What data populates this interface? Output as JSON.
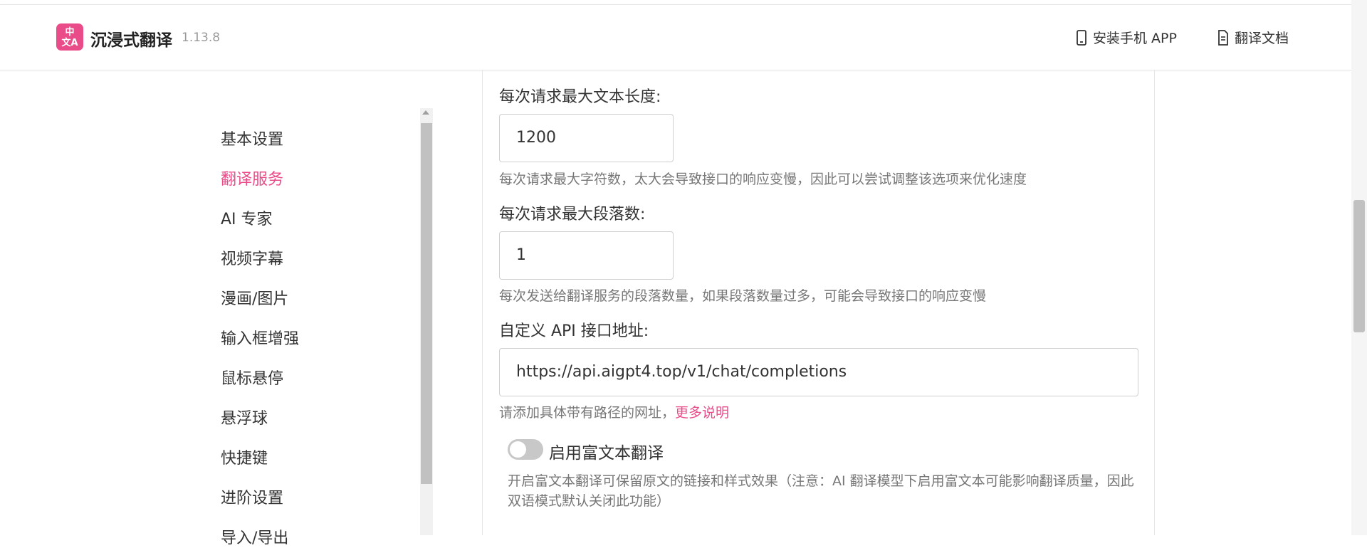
{
  "header": {
    "logo_text_top": "中",
    "logo_text_bottom": "文A",
    "app_title": "沉浸式翻译",
    "version": "1.13.8",
    "links": [
      {
        "label": "安装手机 APP",
        "icon": "phone-icon"
      },
      {
        "label": "翻译文档",
        "icon": "document-icon"
      }
    ]
  },
  "sidebar": {
    "items": [
      {
        "label": "基本设置",
        "active": false
      },
      {
        "label": "翻译服务",
        "active": true
      },
      {
        "label": "AI 专家",
        "active": false
      },
      {
        "label": "视频字幕",
        "active": false
      },
      {
        "label": "漫画/图片",
        "active": false
      },
      {
        "label": "输入框增强",
        "active": false
      },
      {
        "label": "鼠标悬停",
        "active": false
      },
      {
        "label": "悬浮球",
        "active": false
      },
      {
        "label": "快捷键",
        "active": false
      },
      {
        "label": "进阶设置",
        "active": false
      },
      {
        "label": "导入/导出",
        "active": false
      }
    ]
  },
  "form": {
    "max_text_length": {
      "label": "每次请求最大文本长度:",
      "value": "1200",
      "help": "每次请求最大字符数，太大会导致接口的响应变慢，因此可以尝试调整该选项来优化速度"
    },
    "max_paragraphs": {
      "label": "每次请求最大段落数:",
      "value": "1",
      "help": "每次发送给翻译服务的段落数量，如果段落数量过多，可能会导致接口的响应变慢"
    },
    "api_url": {
      "label": "自定义 API 接口地址:",
      "value": "https://api.aigpt4.top/v1/chat/completions",
      "help": "请添加具体带有路径的网址，",
      "help_link": "更多说明"
    },
    "rich_text": {
      "label": "启用富文本翻译",
      "enabled": false,
      "desc": "开启富文本翻译可保留原文的链接和样式效果（注意：AI 翻译模型下启用富文本可能影响翻译质量，因此双语模式默认关闭此功能）"
    }
  },
  "colors": {
    "accent": "#ea4c89",
    "text": "#333333",
    "muted": "#777777"
  }
}
